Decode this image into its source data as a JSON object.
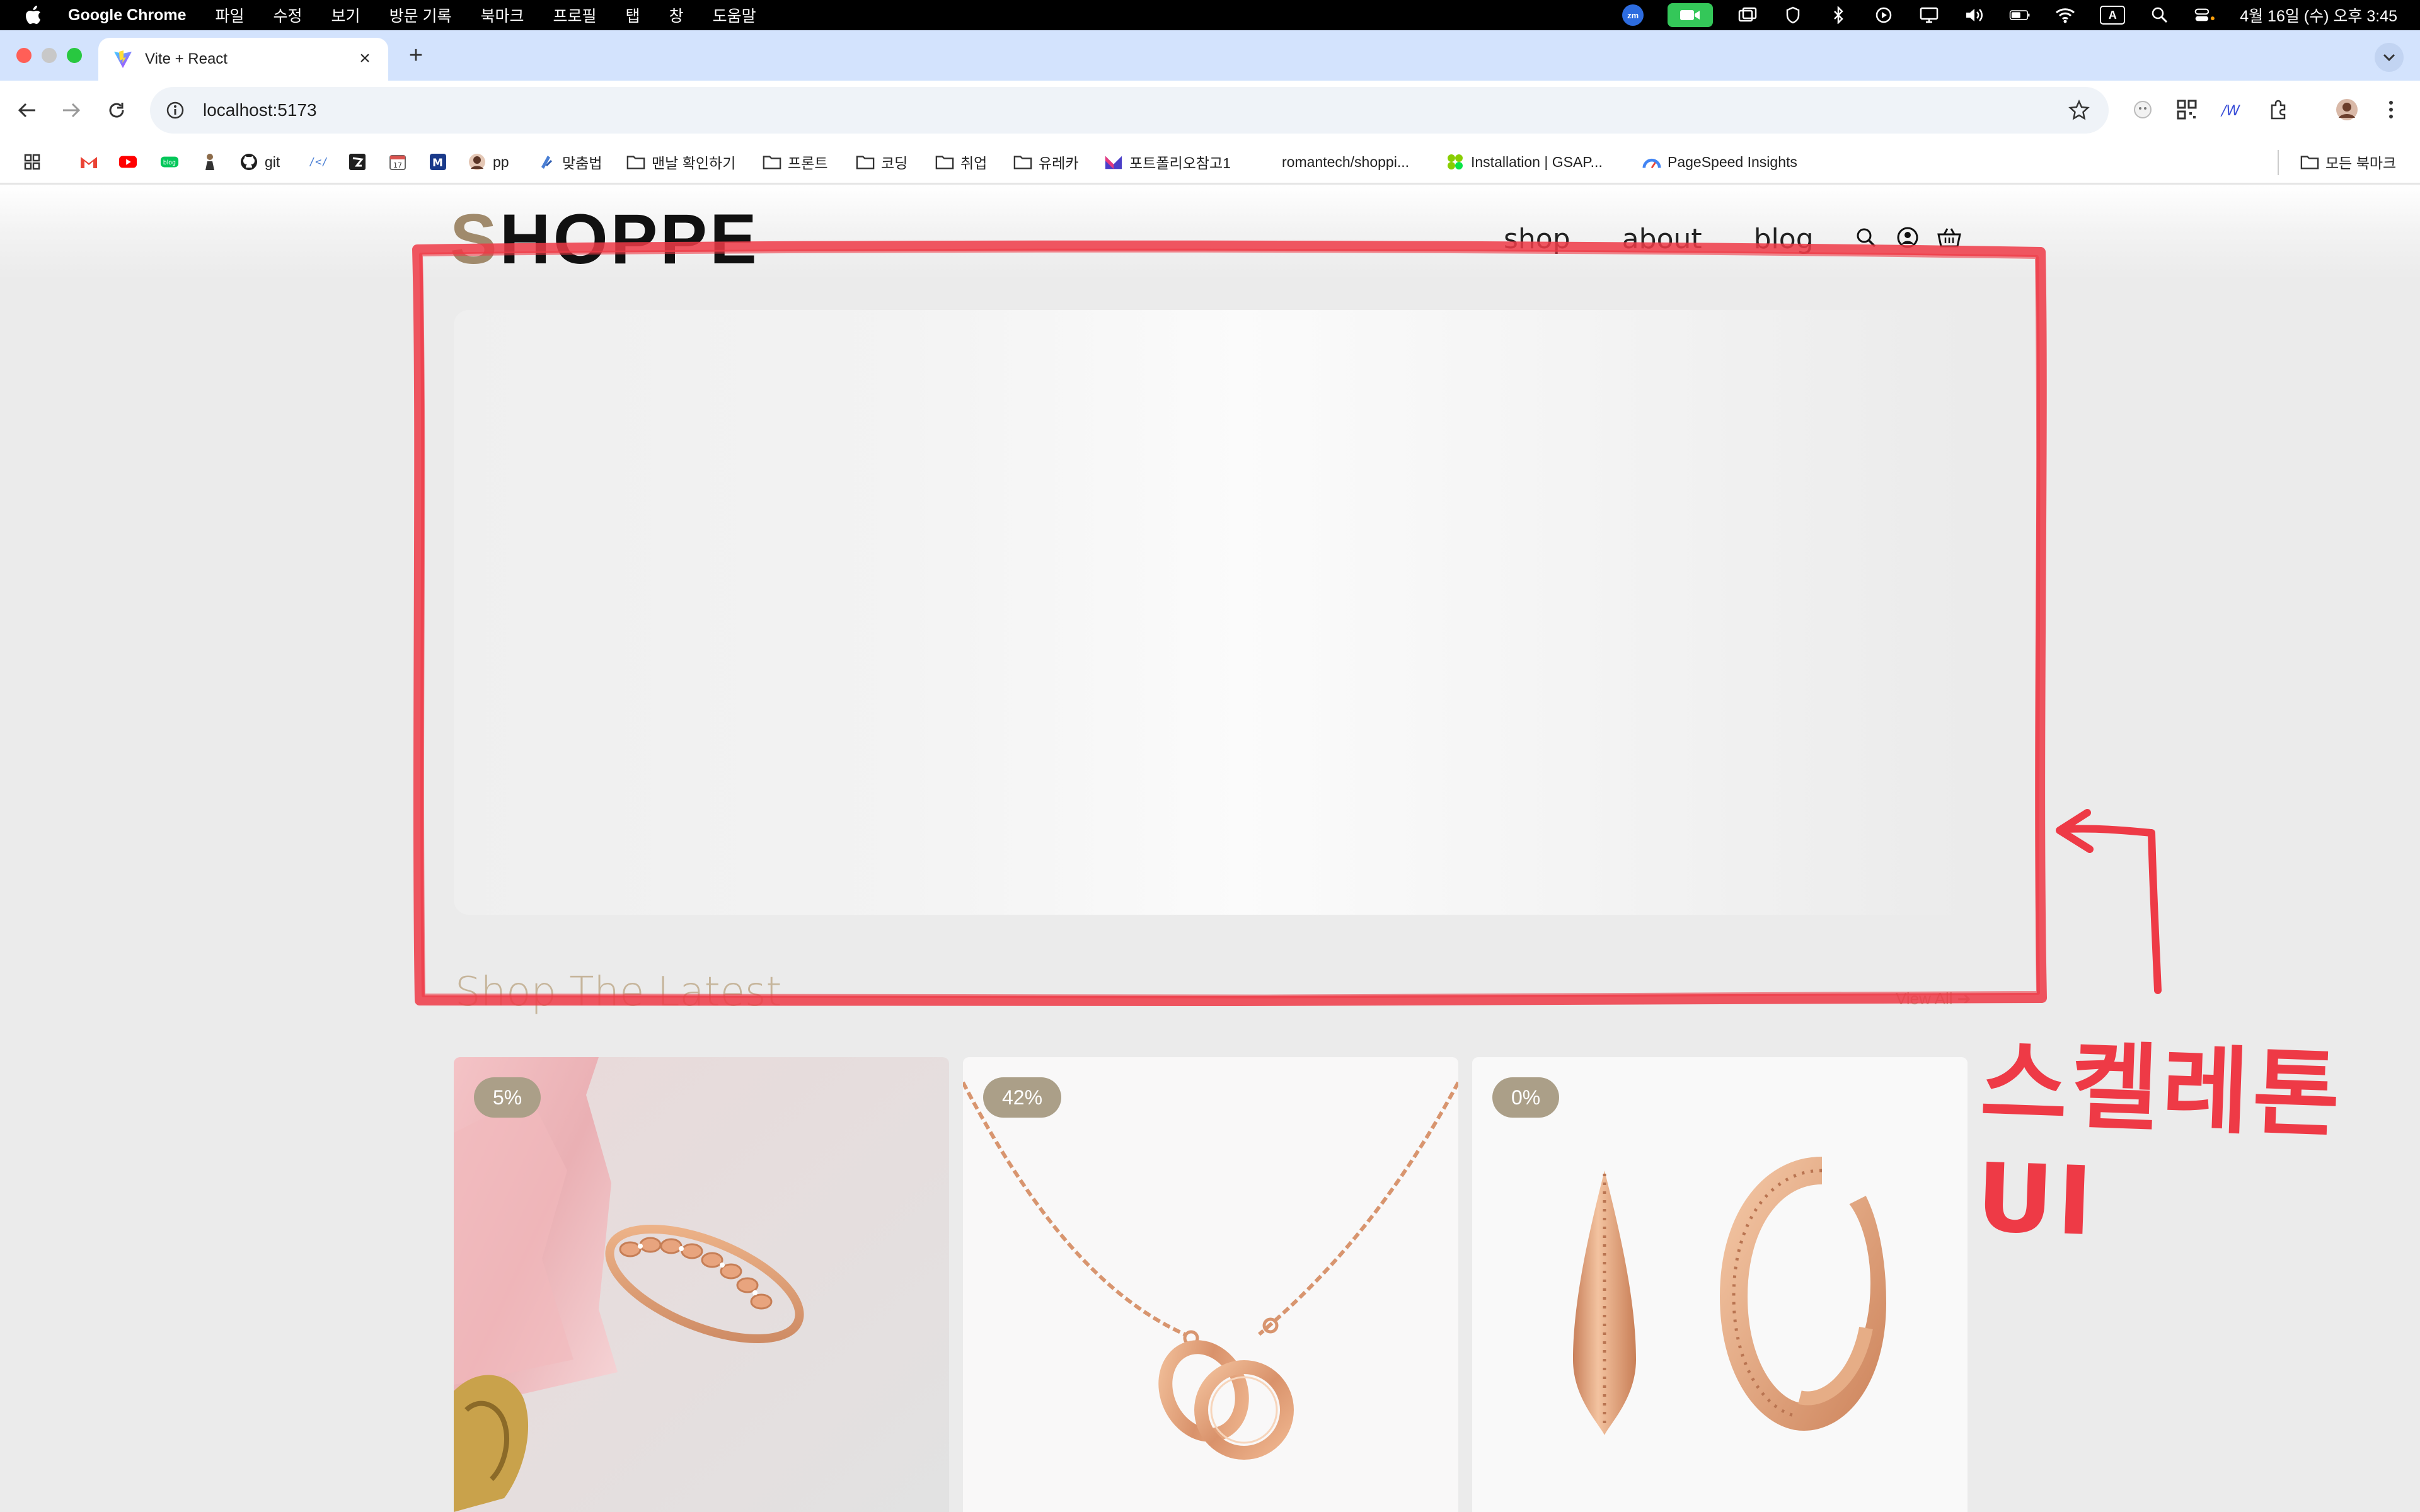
{
  "menubar": {
    "app_name": "Google Chrome",
    "menus": [
      "파일",
      "수정",
      "보기",
      "방문 기록",
      "북마크",
      "프로필",
      "탭",
      "창",
      "도움말"
    ],
    "zoom_badge": "zm",
    "input_source": "A",
    "clock": "4월 16일 (수) 오후 3:45"
  },
  "browser": {
    "tab_title": "Vite + React",
    "url": "localhost:5173",
    "bookmarks": [
      {
        "label": "",
        "icon": "apps-grid-icon"
      },
      {
        "label": "",
        "icon": "gmail-icon"
      },
      {
        "label": "",
        "icon": "youtube-icon"
      },
      {
        "label": "",
        "icon": "blog-icon"
      },
      {
        "label": "",
        "icon": "figure-icon"
      },
      {
        "label": "git",
        "icon": "github-icon"
      },
      {
        "label": "",
        "icon": "code-icon"
      },
      {
        "label": "",
        "icon": "velog-icon"
      },
      {
        "label": "",
        "icon": "calendar-icon"
      },
      {
        "label": "",
        "icon": "m-icon"
      },
      {
        "label": "pp",
        "icon": "profile-icon"
      },
      {
        "label": "맞춤법",
        "icon": "spell-icon"
      },
      {
        "label": "맨날 확인하기",
        "icon": "folder-icon"
      },
      {
        "label": "프론트",
        "icon": "folder-icon"
      },
      {
        "label": "코딩",
        "icon": "folder-icon"
      },
      {
        "label": "취업",
        "icon": "folder-icon"
      },
      {
        "label": "유레카",
        "icon": "folder-icon"
      },
      {
        "label": "포트폴리오참고1",
        "icon": "m-logo-icon"
      },
      {
        "label": "romantech/shoppi...",
        "icon": "none"
      },
      {
        "label": "Installation | GSAP...",
        "icon": "gsap-icon"
      },
      {
        "label": "PageSpeed Insights",
        "icon": "pagespeed-icon"
      }
    ],
    "all_bookmarks": "모든 북마크"
  },
  "site": {
    "logo_first": "S",
    "logo_rest": "HOPPE",
    "nav": [
      "shop",
      "about",
      "blog"
    ],
    "section_title": "Shop The Latest",
    "view_all": "View All",
    "products": [
      {
        "discount": "5%",
        "image": "rose-gold-ring"
      },
      {
        "discount": "42%",
        "image": "rose-gold-necklace"
      },
      {
        "discount": "0%",
        "image": "rose-gold-earrings"
      }
    ]
  },
  "annotation": {
    "label": "스켈레톤 UI",
    "color": "#ee3a46"
  },
  "colors": {
    "accent": "#a08a6c",
    "badge": "#ab9f88",
    "tab_strip": "#d3e3fd"
  }
}
